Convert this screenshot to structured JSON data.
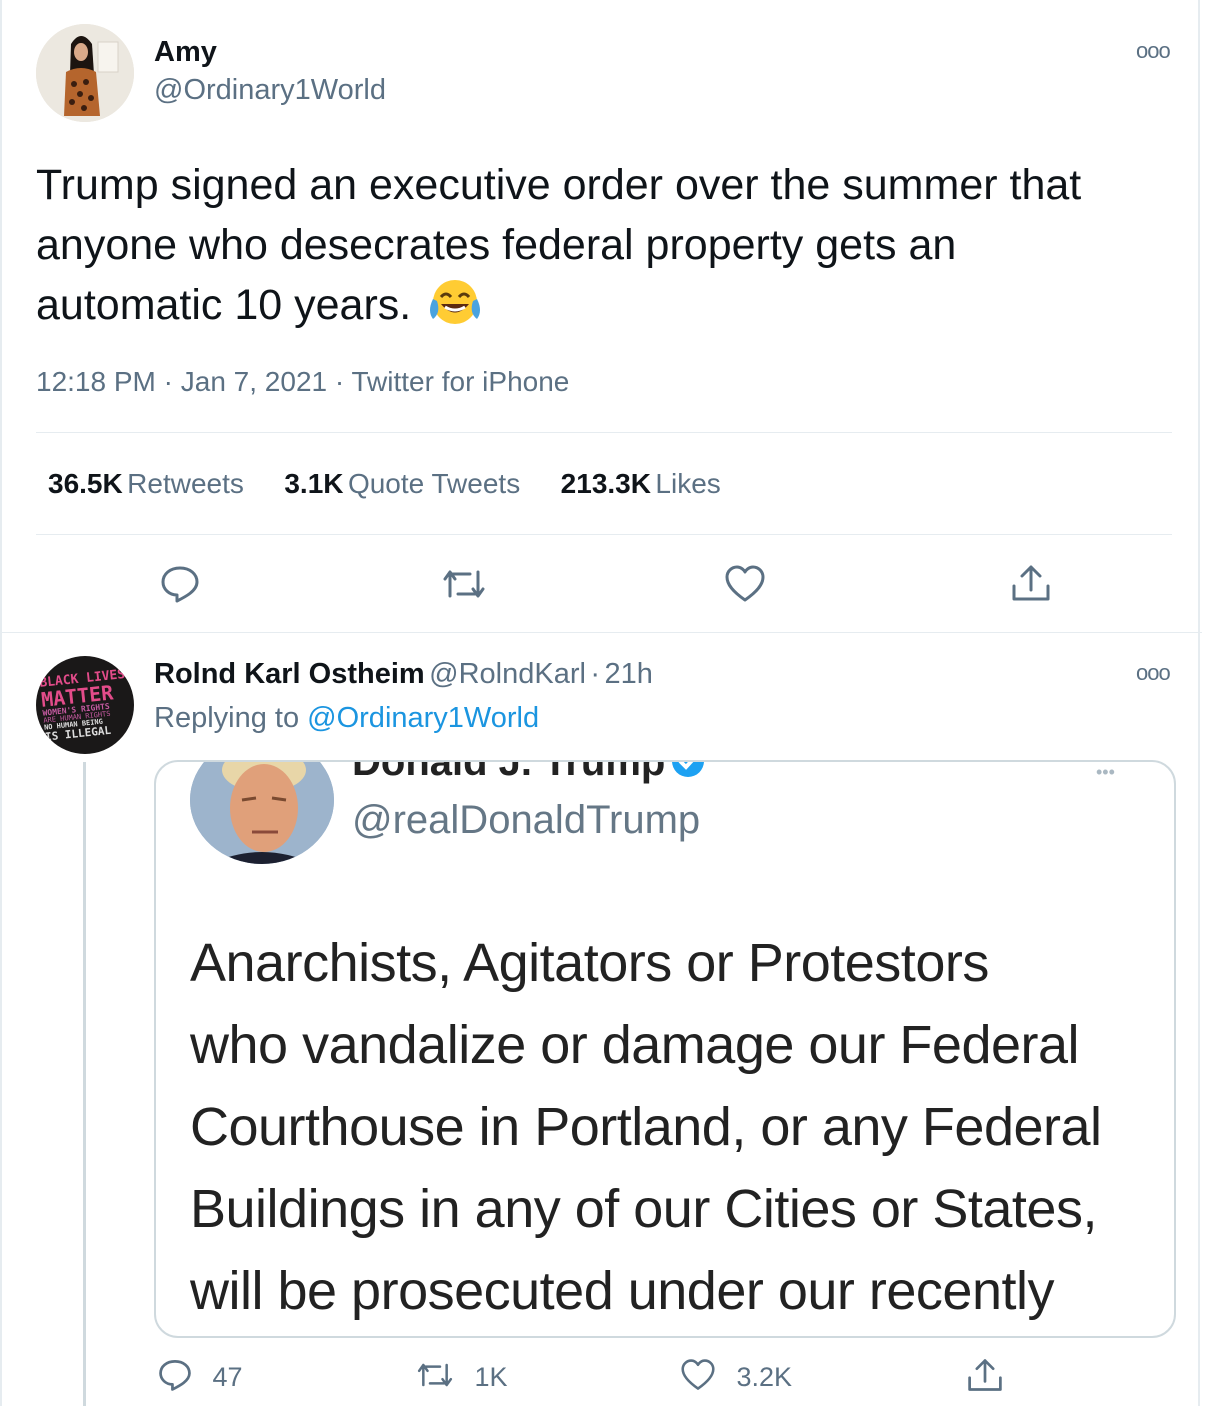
{
  "main_tweet": {
    "author_name": "Amy",
    "author_handle": "@Ordinary1World",
    "more_label": "ooo",
    "text": "Trump signed an executive order over the summer that anyone who desecrates federal property gets an automatic 10 years.",
    "emoji": "😂",
    "time": "12:18 PM",
    "date": "Jan 7, 2021",
    "source": "Twitter for iPhone",
    "separator": "·",
    "stats": {
      "retweets_count": "36.5K",
      "retweets_label": "Retweets",
      "quotes_count": "3.1K",
      "quotes_label": "Quote Tweets",
      "likes_count": "213.3K",
      "likes_label": "Likes"
    },
    "actions": [
      "reply-icon",
      "retweet-icon",
      "like-icon",
      "share-icon"
    ]
  },
  "reply_tweet": {
    "author_name": "Rolnd Karl Ostheim",
    "author_handle": "@RolndKarl",
    "separator": "·",
    "age": "21h",
    "more_label": "ooo",
    "replying_prefix": "Replying to",
    "replying_handle": "@Ordinary1World",
    "avatar_text": {
      "line1": "BLACK LIVES",
      "line2": "MATTER",
      "line3": "WOMEN'S RIGHTS",
      "line4": "ARE HUMAN RIGHTS",
      "line5": "NO HUMAN BEING",
      "line6": "IS ILLEGAL"
    },
    "embedded_screenshot": {
      "name": "Donald J. Trump",
      "handle": "@realDonaldTrump",
      "text_lines": [
        "Anarchists, Agitators or Protestors",
        "who vandalize or damage our Federal",
        "Courthouse in Portland, or any Federal",
        "Buildings in any of our Cities or States,",
        "will be prosecuted under our recently"
      ]
    },
    "counts": {
      "replies": "47",
      "retweets": "1K",
      "likes": "3.2K"
    }
  },
  "colors": {
    "secondary_text": "#5b7083",
    "link": "#1b95e0",
    "divider": "#e6ecf0",
    "verified": "#1da1f2"
  }
}
